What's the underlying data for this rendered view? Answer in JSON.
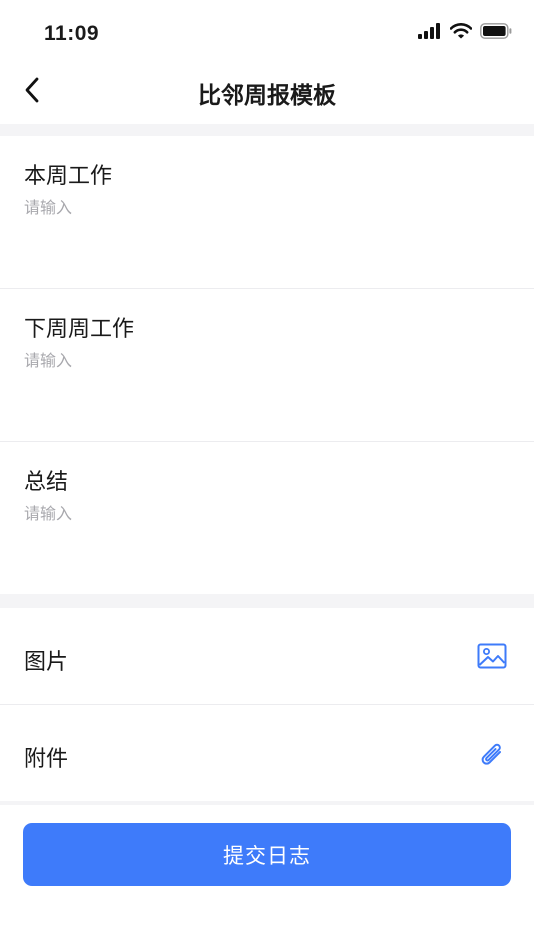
{
  "status_bar": {
    "time": "11:09",
    "icons": [
      "signal-icon",
      "wifi-icon",
      "battery-icon"
    ]
  },
  "nav": {
    "title": "比邻周报模板",
    "back_icon": "chevron-left-icon"
  },
  "fields": [
    {
      "label": "本周工作",
      "placeholder": "请输入",
      "value": ""
    },
    {
      "label": "下周周工作",
      "placeholder": "请输入",
      "value": ""
    },
    {
      "label": "总结",
      "placeholder": "请输入",
      "value": ""
    }
  ],
  "attachments": [
    {
      "label": "图片",
      "icon": "image-icon"
    },
    {
      "label": "附件",
      "icon": "paperclip-icon"
    }
  ],
  "submit": {
    "label": "提交日志"
  },
  "colors": {
    "accent": "#3e7bfa",
    "section_gap": "#f4f4f6",
    "placeholder": "#a8a8ad",
    "divider": "#ececef"
  }
}
